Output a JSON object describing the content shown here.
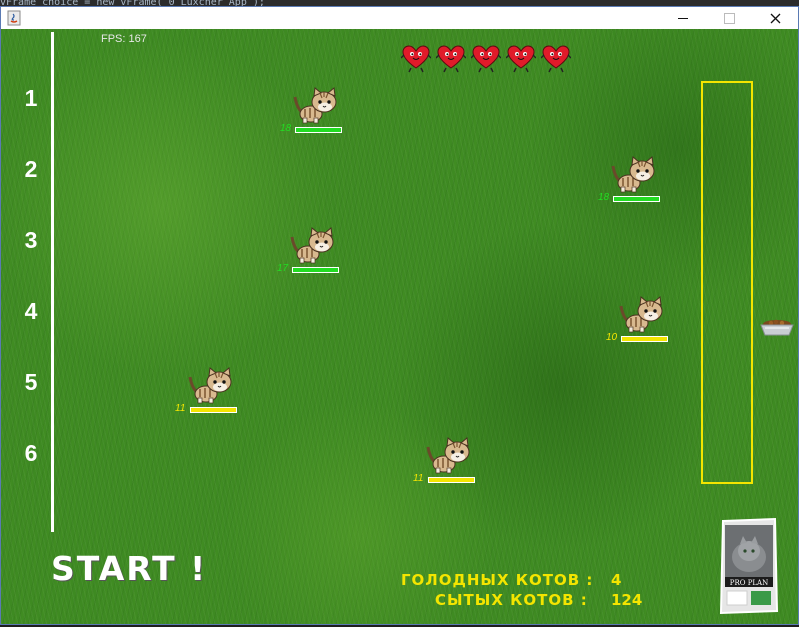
{
  "background_code": "vFrame choice = new vFrame( 0 Luxcher App );",
  "window": {
    "title": "",
    "minimize_label": "—",
    "maximize_label": "☐",
    "close_label": "✕"
  },
  "game": {
    "fps_text": "FPS: 167",
    "lanes": [
      "1",
      "2",
      "3",
      "4",
      "5",
      "6"
    ],
    "lives": 5,
    "cats": [
      {
        "lane": 1,
        "label": "18",
        "status": "green",
        "fill": 1.0
      },
      {
        "lane": 2,
        "label": "18",
        "status": "green",
        "fill": 1.0
      },
      {
        "lane": 3,
        "label": "17",
        "status": "green",
        "fill": 1.0
      },
      {
        "lane": 4,
        "label": "10",
        "status": "yellow",
        "fill": 1.0
      },
      {
        "lane": 5,
        "label": "11",
        "status": "yellow",
        "fill": 1.0
      },
      {
        "lane": 6,
        "label": "11",
        "status": "yellow",
        "fill": 1.0
      }
    ],
    "start_label": "START !",
    "hungry_label": "ГОЛОДНЫХ КОТОВ :",
    "hungry_count": "4",
    "fed_label": "СЫТЫХ КОТОВ :",
    "fed_count": "124",
    "bag_brand": "PRO PLAN"
  },
  "colors": {
    "grass": "#3e8a22",
    "lane_line": "#ffffff",
    "goal_zone": "#f4e500",
    "text_yellow": "#f4e500",
    "status_green": "#22dd22",
    "status_yellow": "#f4e500",
    "heart": "#e01b2a"
  },
  "icons": [
    "java-icon",
    "heart-icon",
    "cat-icon",
    "food-bowl-icon",
    "food-bag-icon"
  ]
}
